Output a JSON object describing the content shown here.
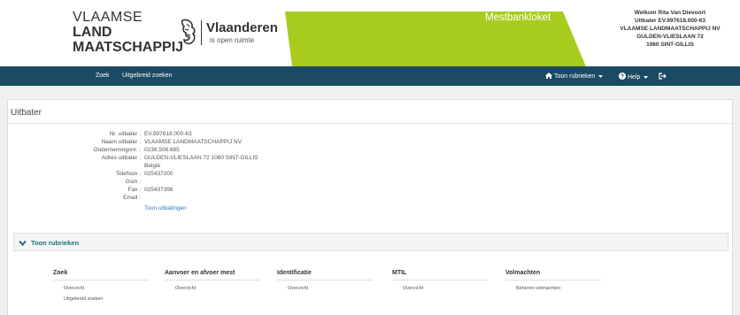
{
  "header": {
    "org_line1": "VLAAMSE",
    "org_line2": "LAND",
    "org_line3": "MAATSCHAPPIJ",
    "vl_name": "Vlaanderen",
    "vl_tagline": "is open ruimte",
    "app_title": "Mestbankloket",
    "welcome": "Welkom Rita Van Dievoort",
    "uitbater_line": "Uitbater EV.997618.000-63",
    "company": "VLAAMSE LANDMAATSCHAPPIJ NV",
    "street": "GULDEN-VLIESLAAN 72",
    "city": "1060 SINT-GILLIS",
    "accent_color": "#a8cc1f"
  },
  "nav": {
    "zoek": "Zoek",
    "uitgebreid": "Uitgebreid zoeken",
    "toon_rubrieken": "Toon rubrieken",
    "help": "Help",
    "logout_icon": "sign-out-icon",
    "bg_color": "#1b4a63"
  },
  "panel": {
    "title": "Uitbater",
    "rows": [
      {
        "label": "Nr. uitbater :",
        "value": "EV.997618.000-63"
      },
      {
        "label": "Naam uitbater :",
        "value": "VLAAMSE LANDMAATSCHAPPIJ NV"
      },
      {
        "label": "Ondernemingsnr. :",
        "value": "0236.506.685"
      },
      {
        "label": "Adres uitbater :",
        "value": "GULDEN-VLIESLAAN 72 1060 SINT-GILLIS"
      },
      {
        "label": "",
        "value": "België"
      },
      {
        "label": "Telefoon :",
        "value": "025437200"
      },
      {
        "label": "Gsm :",
        "value": ""
      },
      {
        "label": "Fax :",
        "value": "025437398"
      },
      {
        "label": "Email :",
        "value": ""
      }
    ],
    "link_uitbatingen": "Toon uitbatingen"
  },
  "rubrieken": {
    "toggle_label": "Toon rubrieken",
    "columns": [
      {
        "title": "Zoek",
        "items": [
          "Overzicht",
          "Uitgebreid zoeken"
        ]
      },
      {
        "title": "Aanvoer en afvoer mest",
        "items": [
          "Overzicht"
        ]
      },
      {
        "title": "Identificatie",
        "items": [
          "Overzicht"
        ]
      },
      {
        "title": "MTIL",
        "items": [
          "Overzicht"
        ]
      },
      {
        "title": "Volmachten",
        "items": [
          "Beheren volmachten"
        ]
      }
    ]
  }
}
